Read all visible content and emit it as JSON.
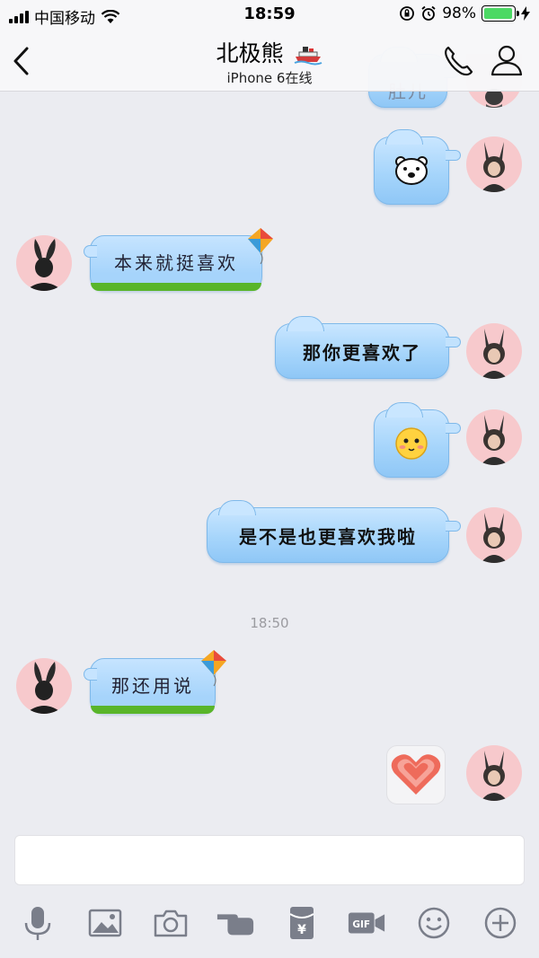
{
  "status": {
    "carrier": "中国移动",
    "time": "18:59",
    "battery": "98%",
    "battery_level": 0.98
  },
  "nav": {
    "title": "北极熊",
    "subtitle": "iPhone 6在线"
  },
  "messages": [
    {
      "from": "me",
      "type": "text",
      "text": "那你更喜欢了"
    },
    {
      "from": "me",
      "type": "text",
      "text": "是不是也更喜欢我啦"
    },
    {
      "from": "them",
      "type": "text",
      "text": "本来就挺喜欢"
    },
    {
      "from": "them",
      "type": "text",
      "text": "那还用说"
    }
  ],
  "partial_top_text": "肚儿",
  "timestamp": "18:50",
  "input": {
    "placeholder": ""
  },
  "toolbar": {
    "gif_label": "GIF",
    "yen_label": "¥"
  },
  "colors": {
    "bubble_blue": "#a6d5fb",
    "grass_green": "#59b52a",
    "avatar_bg": "#f7c9cc",
    "battery_green": "#4cd964"
  }
}
